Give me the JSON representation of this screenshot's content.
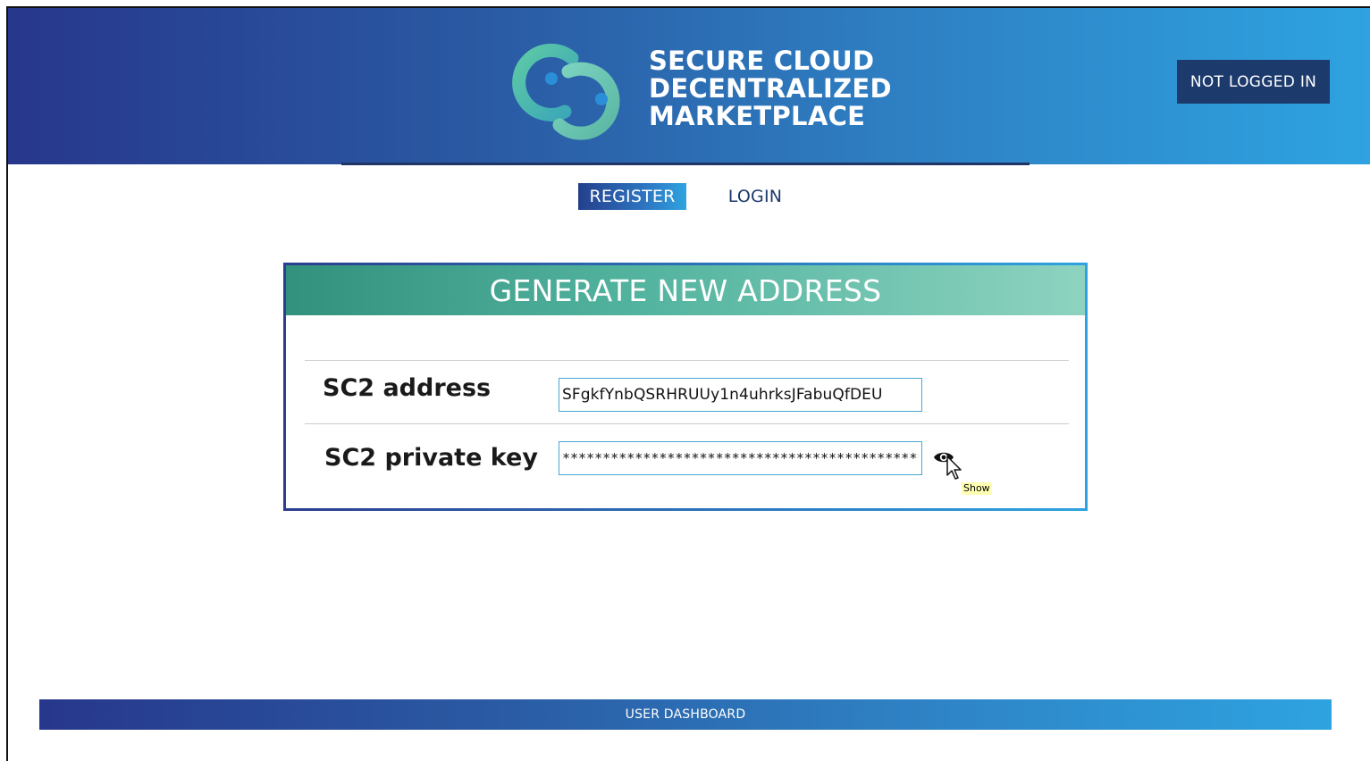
{
  "header": {
    "logo_lines": [
      "SECURE CLOUD",
      "DECENTRALIZED",
      "MARKETPLACE"
    ],
    "status_label": "NOT LOGGED IN"
  },
  "tabs": [
    {
      "label": "REGISTER",
      "active": true
    },
    {
      "label": "LOGIN",
      "active": false
    }
  ],
  "card": {
    "title": "GENERATE NEW ADDRESS",
    "address_label": "SC2 address",
    "address_value": "SFgkfYnbQSRHRUUy1n4uhrksJFabuQfDEU",
    "private_key_label": "SC2 private key",
    "private_key_value": "************************************************",
    "show_icon": "eye-icon",
    "tooltip": "Show"
  },
  "footer": {
    "label": "USER DASHBOARD"
  },
  "colors": {
    "header_dark": "#27378c",
    "header_light": "#2ea3e0",
    "status_bg": "#1c3a6c",
    "card_header_start": "#32917c",
    "card_header_end": "#8dd3c0"
  }
}
